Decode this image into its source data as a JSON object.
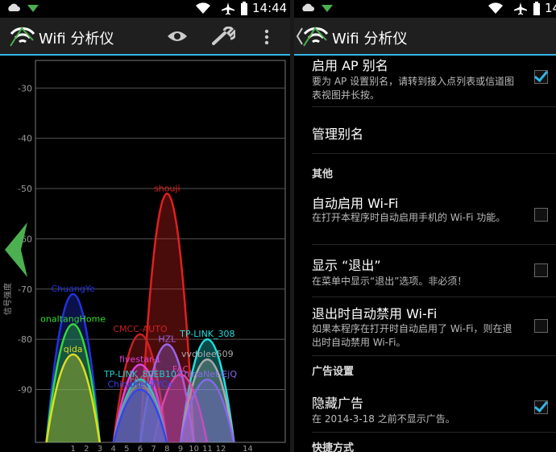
{
  "colors": {
    "accent": "#33b5e5",
    "actionbar": "#1f1f1f",
    "arrow": "#4caf50"
  },
  "left": {
    "status": {
      "time": "14:44"
    },
    "app": {
      "title": "Wifi 分析仪",
      "eye_icon": "eye-icon",
      "wrench_icon": "wrench-icon",
      "overflow_icon": "overflow-menu-icon"
    },
    "chart": {
      "y_axis_label": "信号强度",
      "y_ticks": [
        "-30",
        "-40",
        "-50",
        "-60",
        "-70",
        "-80",
        "-90"
      ],
      "x_ticks": [
        "1",
        "2",
        "3",
        "4",
        "5",
        "6",
        "7",
        "8",
        "9",
        "10",
        "11",
        "12",
        "14"
      ]
    }
  },
  "chart_data": {
    "type": "area",
    "ylabel": "信号强度",
    "ylim": [
      -100,
      -20
    ],
    "y_ticks": [
      -30,
      -40,
      -50,
      -60,
      -70,
      -80,
      -90
    ],
    "x_ticks": [
      1,
      2,
      3,
      4,
      5,
      6,
      7,
      8,
      9,
      10,
      11,
      12,
      14
    ],
    "series": [
      {
        "name": "shouji",
        "channel": 8,
        "dbm": -51,
        "color": "#e02020"
      },
      {
        "name": "ChuangYe",
        "channel": 1,
        "dbm": -71,
        "color": "#2233dd"
      },
      {
        "name": "onaltangHome",
        "channel": 1,
        "dbm": -77,
        "color": "#33dd33"
      },
      {
        "name": "qida",
        "channel": 1,
        "dbm": -83,
        "color": "#dddd22"
      },
      {
        "name": "CMCC-AUTO",
        "channel": 6,
        "dbm": -79,
        "color": "#cc2222"
      },
      {
        "name": "TP-LINK_308",
        "channel": 11,
        "dbm": -80,
        "color": "#22dddd"
      },
      {
        "name": "HZL",
        "channel": 8,
        "dbm": -81,
        "color": "#9966ee"
      },
      {
        "name": "vvdblee509",
        "channel": 11,
        "dbm": -84,
        "color": "#aaaaaa"
      },
      {
        "name": "fivestar-1",
        "channel": 6,
        "dbm": -85,
        "color": "#dd44dd"
      },
      {
        "name": "FAC",
        "channel": 9,
        "dbm": -87,
        "color": "#dd44aa"
      },
      {
        "name": "ChinaNet-EjQ",
        "channel": 11,
        "dbm": -88,
        "color": "#8866ee"
      },
      {
        "name": "TP-LINK_80EB10",
        "channel": 6,
        "dbm": -88,
        "color": "#22cccc"
      },
      {
        "name": "FAST",
        "channel": 6,
        "dbm": -89,
        "color": "#888888"
      },
      {
        "name": "ChinaNet-TYCe",
        "channel": 6,
        "dbm": -90,
        "color": "#3344ee"
      }
    ]
  },
  "right": {
    "status": {
      "time": "14"
    },
    "app": {
      "title": "Wifi 分析仪"
    },
    "settings": {
      "alias_title": "启用 AP 别名",
      "alias_summary": "要为 AP 设置别名，请转到接入点列表或信道图表视图并长按。",
      "manage_alias": "管理别名",
      "header_other": "其他",
      "autostart_title": "自动启用 Wi-Fi",
      "autostart_summary": "在打开本程序时自动启用手机的 Wi-Fi 功能。",
      "show_exit_title": "显示 “退出”",
      "show_exit_summary": "在菜单中显示“退出”选项。非必须！",
      "auto_disable_title": "退出时自动禁用 Wi-Fi",
      "auto_disable_summary": "如果本程序在打开时自动启用了 Wi-Fi，则在退出时自动禁用 Wi-Fi。",
      "header_ads": "广告设置",
      "hide_ads_title": "隐藏广告",
      "hide_ads_summary": "在 2014-3-18 之前不显示广告。",
      "header_shortcut": "快捷方式"
    }
  }
}
